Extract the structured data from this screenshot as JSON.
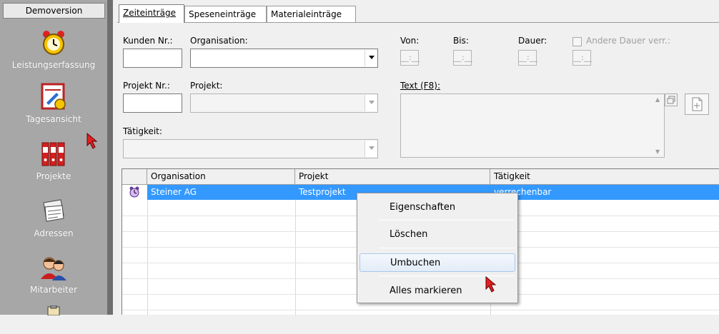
{
  "sidebar": {
    "title": "Demoversion",
    "items": [
      {
        "label": "Leistungserfassung",
        "icon": "alarm-clock-icon"
      },
      {
        "label": "Tagesansicht",
        "icon": "calendar-clock-icon"
      },
      {
        "label": "Projekte",
        "icon": "binders-icon"
      },
      {
        "label": "Adressen",
        "icon": "address-book-icon"
      },
      {
        "label": "Mitarbeiter",
        "icon": "people-icon"
      }
    ]
  },
  "tabs": [
    "Zeiteinträge",
    "Speseneinträge",
    "Materialeinträge"
  ],
  "form": {
    "kunden_nr_label": "Kunden Nr.:",
    "organisation_label": "Organisation:",
    "von_label": "Von:",
    "bis_label": "Bis:",
    "dauer_label": "Dauer:",
    "andere_dauer_label": "Andere Dauer verr.:",
    "time_placeholder": "__:__",
    "projekt_nr_label": "Projekt Nr.:",
    "projekt_label": "Projekt:",
    "text_label": "Text (F8):",
    "taetigkeit_label": "Tätigkeit:"
  },
  "grid": {
    "columns": [
      "Organisation",
      "Projekt",
      "Tätigkeit"
    ],
    "rows": [
      {
        "organisation": "Steiner AG",
        "projekt": "Testprojekt ",
        "taetigkeit": " verrechenbar"
      }
    ]
  },
  "context_menu": {
    "items": [
      "Eigenschaften",
      "Löschen",
      "Umbuchen",
      "Alles markieren"
    ],
    "highlighted": "Umbuchen"
  },
  "colors": {
    "selection": "#3399ff",
    "sidebar": "#a7a7a7"
  }
}
